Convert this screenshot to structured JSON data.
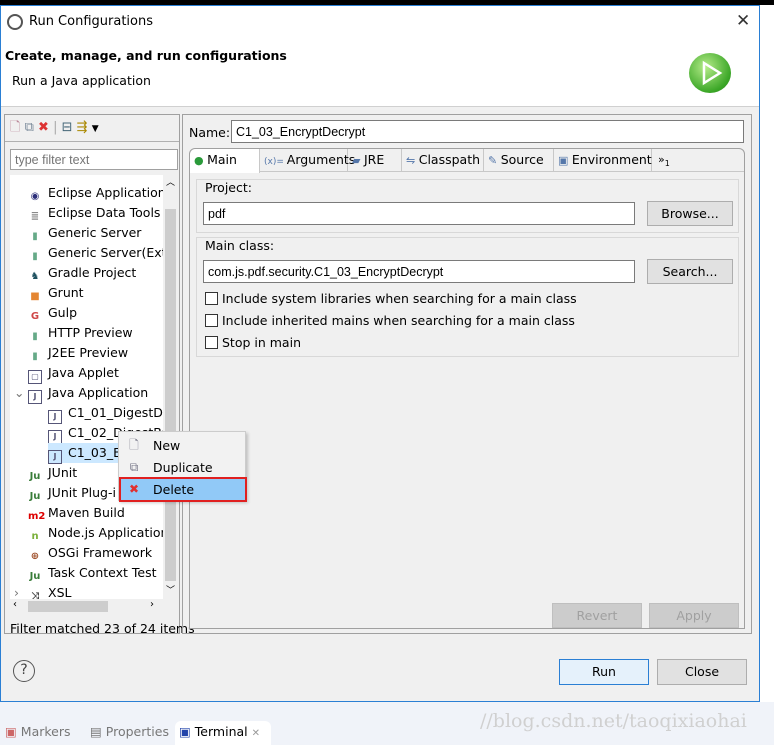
{
  "window": {
    "title": "Run Configurations",
    "close_icon": "close-icon"
  },
  "header": {
    "title": "Create, manage, and run configurations",
    "subtitle": "Run a Java application",
    "icon": "run-play-icon"
  },
  "left": {
    "toolbar": [
      "new-config-icon",
      "duplicate-icon",
      "delete-icon",
      "collapse-all-icon",
      "filter-icon",
      "dropdown-icon"
    ],
    "filter_placeholder": "type filter text",
    "tree": [
      {
        "label": "Eclipse Application",
        "icon": "eclipse-icon",
        "color": "#2c2f7a"
      },
      {
        "label": "Eclipse Data Tools",
        "icon": "database-icon",
        "color": "#888"
      },
      {
        "label": "Generic Server",
        "icon": "server-icon",
        "color": "#6a8"
      },
      {
        "label": "Generic Server(Exte",
        "icon": "server-icon",
        "color": "#6a8"
      },
      {
        "label": "Gradle Project",
        "icon": "gradle-icon",
        "color": "#1c4f5e"
      },
      {
        "label": "Grunt",
        "icon": "grunt-icon",
        "color": "#e48632"
      },
      {
        "label": "Gulp",
        "icon": "gulp-icon",
        "color": "#cf4647"
      },
      {
        "label": "HTTP Preview",
        "icon": "server-icon",
        "color": "#6a8"
      },
      {
        "label": "J2EE Preview",
        "icon": "server-icon",
        "color": "#6a8"
      },
      {
        "label": "Java Applet",
        "icon": "applet-icon",
        "color": "#557"
      },
      {
        "label": "Java Application",
        "icon": "java-app-icon",
        "color": "#557",
        "expanded": true
      },
      {
        "label": "C1_01_DigestDe",
        "icon": "java-config-icon",
        "color": "#557",
        "child": true
      },
      {
        "label": "C1_02_DigestBC",
        "icon": "java-config-icon",
        "color": "#557",
        "child": true
      },
      {
        "label": "C1_03_E",
        "icon": "java-config-icon",
        "color": "#557",
        "child": true,
        "selected": true
      },
      {
        "label": "JUnit",
        "icon": "junit-icon",
        "color": "#3a7d3a"
      },
      {
        "label": "JUnit Plug-i",
        "icon": "junit-plugin-icon",
        "color": "#3a7d3a"
      },
      {
        "label": "Maven Build",
        "icon": "maven-icon",
        "color": "#d00"
      },
      {
        "label": "Node.js Application",
        "icon": "nodejs-icon",
        "color": "#7bb03a"
      },
      {
        "label": "OSGi Framework",
        "icon": "osgi-icon",
        "color": "#a0522d"
      },
      {
        "label": "Task Context Test",
        "icon": "task-junit-icon",
        "color": "#3a7d3a"
      },
      {
        "label": "XSL",
        "icon": "xsl-icon",
        "color": "#444",
        "collapsed": true
      }
    ],
    "status": "Filter matched 23 of 24 items"
  },
  "context_menu": {
    "items": [
      {
        "label": "New",
        "icon": "new-icon"
      },
      {
        "label": "Duplicate",
        "icon": "duplicate-icon"
      },
      {
        "label": "Delete",
        "icon": "delete-icon",
        "highlighted": true
      }
    ]
  },
  "right": {
    "name_label": "Name:",
    "name_value": "C1_03_EncryptDecrypt",
    "tabs": [
      {
        "label": "Main",
        "icon": "main-tab-icon",
        "active": true
      },
      {
        "label": "Arguments",
        "icon": "arguments-icon"
      },
      {
        "label": "JRE",
        "icon": "jre-icon"
      },
      {
        "label": "Classpath",
        "icon": "classpath-icon"
      },
      {
        "label": "Source",
        "icon": "source-icon"
      },
      {
        "label": "Environment",
        "icon": "environment-icon"
      }
    ],
    "tabs_overflow": "»",
    "tabs_overflow_count": "1",
    "project_label": "Project:",
    "project_value": "pdf",
    "browse": "Browse...",
    "mainclass_label": "Main class:",
    "mainclass_value": "com.js.pdf.security.C1_03_EncryptDecrypt",
    "search": "Search...",
    "options": [
      {
        "label": "Include system libraries when searching for a main class",
        "checked": false
      },
      {
        "label": "Include inherited mains when searching for a main class",
        "checked": false
      },
      {
        "label": "Stop in main",
        "checked": false
      }
    ],
    "revert": "Revert",
    "apply": "Apply"
  },
  "footer": {
    "help_icon": "help-icon",
    "run": "Run",
    "close": "Close"
  },
  "background": {
    "tabs": [
      {
        "label": "Markers",
        "icon": "markers-icon"
      },
      {
        "label": "Properties",
        "icon": "properties-icon"
      },
      {
        "label": "Terminal",
        "icon": "terminal-icon",
        "active": true
      }
    ],
    "watermark": "//blog.csdn.net/taoqixiaohai"
  }
}
